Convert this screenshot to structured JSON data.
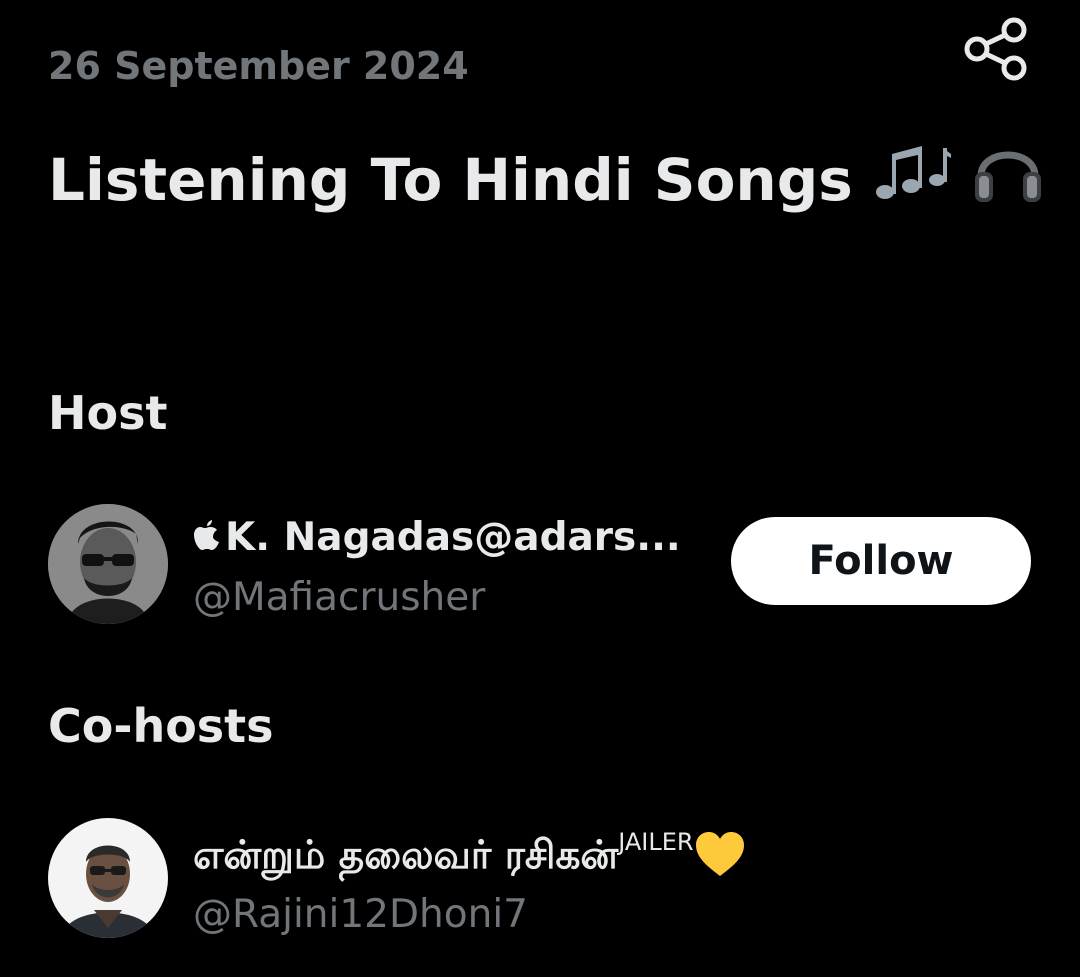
{
  "space": {
    "date": "26 September 2024",
    "title": "Listening To Hindi Songs",
    "title_emoji": [
      "musical-notes",
      "headphones"
    ]
  },
  "host_section": {
    "heading": "Host",
    "user": {
      "display_name": "K. Nagadas@adars...",
      "name_prefix_icon": "apple-logo",
      "handle": "@Mafiacrusher",
      "follow_label": "Follow"
    }
  },
  "cohost_section": {
    "heading": "Co-hosts",
    "user": {
      "display_name": "என்றும் தலைவர் ரசிகன்",
      "name_superscript": "JAILER",
      "name_suffix_icon": "yellow-heart",
      "handle": "@Rajini12Dhoni7"
    }
  },
  "colors": {
    "background": "#000000",
    "primary_text": "#e7e9ea",
    "secondary_text": "#71767b",
    "follow_button_bg": "#ffffff",
    "follow_button_text": "#0f1419",
    "heart": "#ffc93c"
  }
}
